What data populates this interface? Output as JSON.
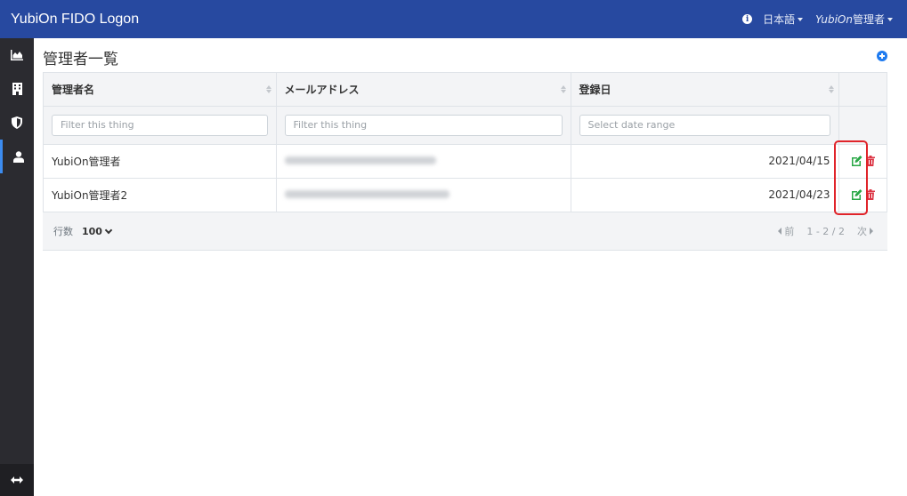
{
  "navbar": {
    "brand": "YubiOn FIDO Logon",
    "language": "日本語",
    "user_prefix": "YubiOn",
    "user_suffix": "管理者"
  },
  "sidebar": {
    "items": [
      {
        "icon": "chart-area-icon",
        "active": false
      },
      {
        "icon": "building-icon",
        "active": false
      },
      {
        "icon": "shield-icon",
        "active": false
      },
      {
        "icon": "user-icon",
        "active": true
      }
    ],
    "bottom_icon": "arrows-horizontal-icon"
  },
  "page": {
    "title": "管理者一覧"
  },
  "table": {
    "columns": [
      "管理者名",
      "メールアドレス",
      "登録日"
    ],
    "filters": {
      "name_placeholder": "Filter this thing",
      "email_placeholder": "Filter this thing",
      "date_placeholder": "Select date range"
    },
    "rows": [
      {
        "name": "YubiOn管理者",
        "date": "2021/04/15"
      },
      {
        "name": "YubiOn管理者2",
        "date": "2021/04/23"
      }
    ]
  },
  "footer": {
    "rows_label": "行数",
    "rows_value": "100",
    "prev": "前",
    "range": "1 - 2 / 2",
    "next": "次"
  },
  "colors": {
    "navbar": "#2749a0",
    "sidebar": "#2b2b30",
    "edit": "#28a745",
    "delete": "#dc3545",
    "highlight": "#e0242a"
  }
}
